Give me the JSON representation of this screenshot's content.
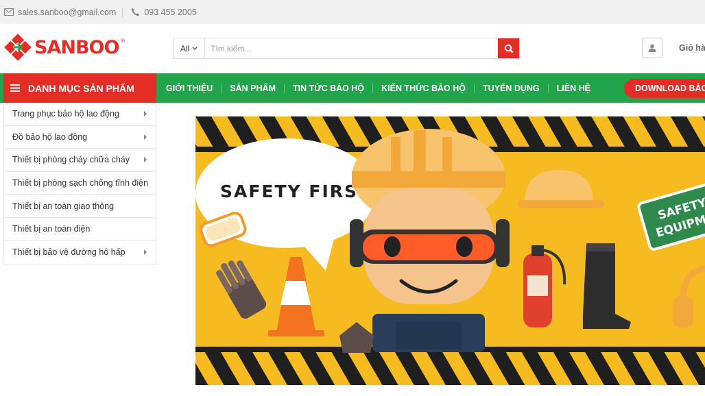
{
  "topbar": {
    "email": "sales.sanboo@gmail.com",
    "phone": "093 455 2005"
  },
  "logo": {
    "text": "SANBOO",
    "reg": "®"
  },
  "search": {
    "category": "All",
    "placeholder": "Tìm kiếm..."
  },
  "cart": {
    "label": "Giỏ hàng"
  },
  "nav": {
    "category_button": "DANH MỤC SẢN PHẨM",
    "items": [
      "GIỚI THIỆU",
      "SẢN PHẨM",
      "TIN TỨC BẢO HỘ",
      "KIẾN THỨC BẢO HỘ",
      "TUYỂN DỤNG",
      "LIÊN HỆ"
    ],
    "download": "DOWNLOAD BẢO"
  },
  "sidebar": {
    "items": [
      {
        "label": "Trang phục bảo hộ lao động",
        "has_submenu": true
      },
      {
        "label": "Đồ bảo hộ lao động",
        "has_submenu": true
      },
      {
        "label": "Thiết bị phòng cháy chữa cháy",
        "has_submenu": true
      },
      {
        "label": "Thiết bị phòng sạch chống tĩnh điện",
        "has_submenu": false
      },
      {
        "label": "Thiết bị an toàn giao thông",
        "has_submenu": false
      },
      {
        "label": "Thiết bị an toàn điện",
        "has_submenu": false
      },
      {
        "label": "Thiết bị bảo vệ đường hô hấp",
        "has_submenu": true
      }
    ]
  },
  "banner": {
    "bubble_text": "SAFETY FIRST",
    "sign_line1": "SAFETY",
    "sign_line2": "EQUIPM"
  },
  "colors": {
    "brand_red": "#e52d27",
    "nav_green": "#21a54b",
    "banner_yellow": "#f5bb20"
  }
}
